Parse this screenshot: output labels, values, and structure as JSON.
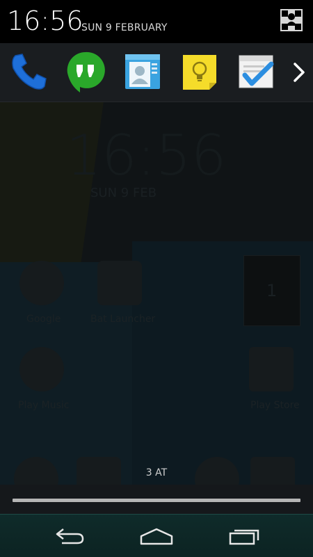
{
  "status": {
    "time": "16:56",
    "date": "SUN 9 FEBRUARY"
  },
  "quick_settings_icon": "user-grid-icon",
  "apps": [
    {
      "name": "Phone",
      "icon": "phone-icon",
      "color": "#1e6fd9"
    },
    {
      "name": "Hangouts",
      "icon": "hangouts-icon",
      "color": "#2aa82a"
    },
    {
      "name": "Contacts",
      "icon": "contacts-icon",
      "color": "#3aa3e0"
    },
    {
      "name": "Keep",
      "icon": "keep-icon",
      "color": "#f5dc2a"
    },
    {
      "name": "Tasks",
      "icon": "tasks-icon",
      "color": "#2c8ee0"
    }
  ],
  "launcher_background": {
    "clock": "16:56",
    "date": "SUN 9 FEB",
    "labels": [
      "Google",
      "Bat Launcher",
      "Play Music",
      "Play Store"
    ],
    "card_value": "1"
  },
  "notification_text": "3 AT",
  "nav": {
    "back": "back-icon",
    "home": "home-icon",
    "recents": "recents-icon"
  }
}
